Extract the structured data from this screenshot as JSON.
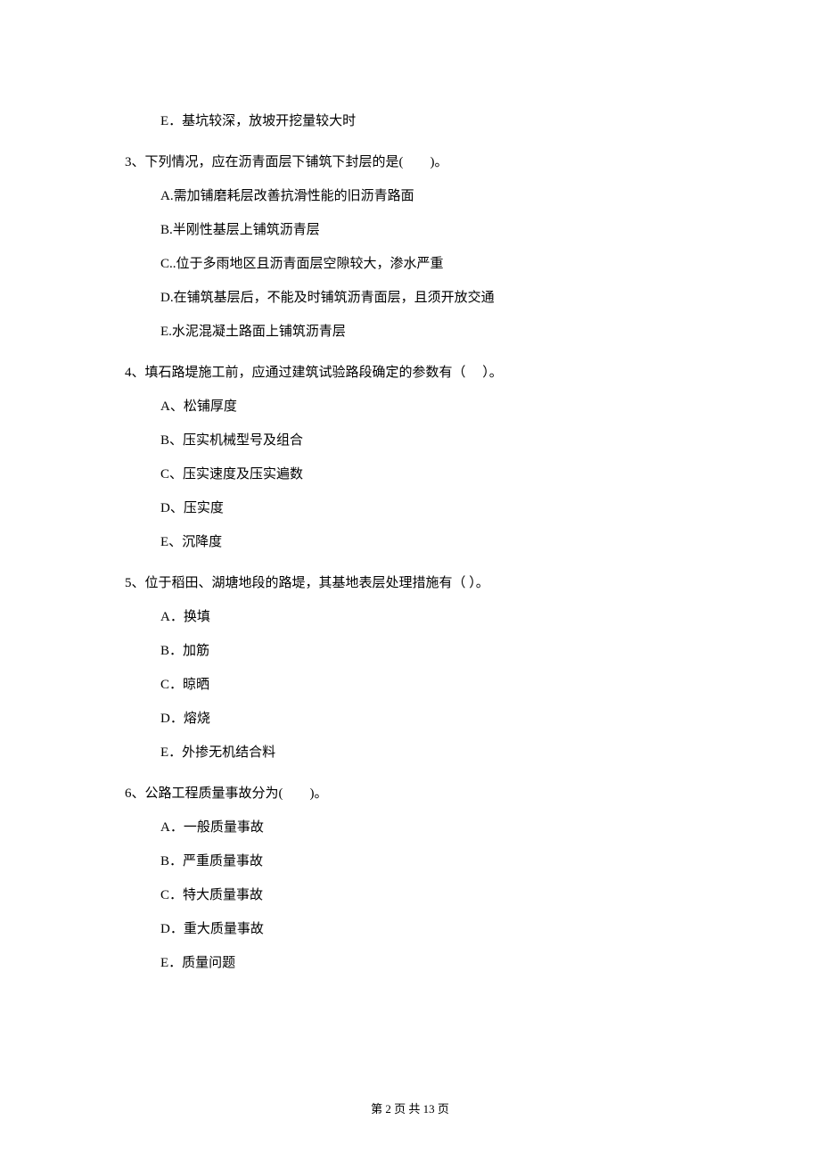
{
  "orphan_option": "E．基坑较深，放坡开挖量较大时",
  "questions": [
    {
      "stem": "3、下列情况，应在沥青面层下铺筑下封层的是(　　)。",
      "options": [
        "A.需加铺磨耗层改善抗滑性能的旧沥青路面",
        "B.半刚性基层上铺筑沥青层",
        "C..位于多雨地区且沥青面层空隙较大，渗水严重",
        "D.在铺筑基层后，不能及时铺筑沥青面层，且须开放交通",
        "E.水泥混凝土路面上铺筑沥青层"
      ]
    },
    {
      "stem": "4、填石路堤施工前，应通过建筑试验路段确定的参数有（　 ）。",
      "options": [
        "A、松铺厚度",
        "B、压实机械型号及组合",
        "C、压实速度及压实遍数",
        "D、压实度",
        "E、沉降度"
      ]
    },
    {
      "stem": "5、位于稻田、湖塘地段的路堤，其基地表层处理措施有（ ）。",
      "options": [
        "A．换填",
        "B．加筋",
        "C．晾晒",
        "D．熔烧",
        "E．外掺无机结合料"
      ]
    },
    {
      "stem": "6、公路工程质量事故分为(　　)。",
      "options": [
        "A．一般质量事故",
        "B．严重质量事故",
        "C．特大质量事故",
        "D．重大质量事故",
        "E．质量问题"
      ]
    }
  ],
  "footer": "第 2 页 共 13 页"
}
